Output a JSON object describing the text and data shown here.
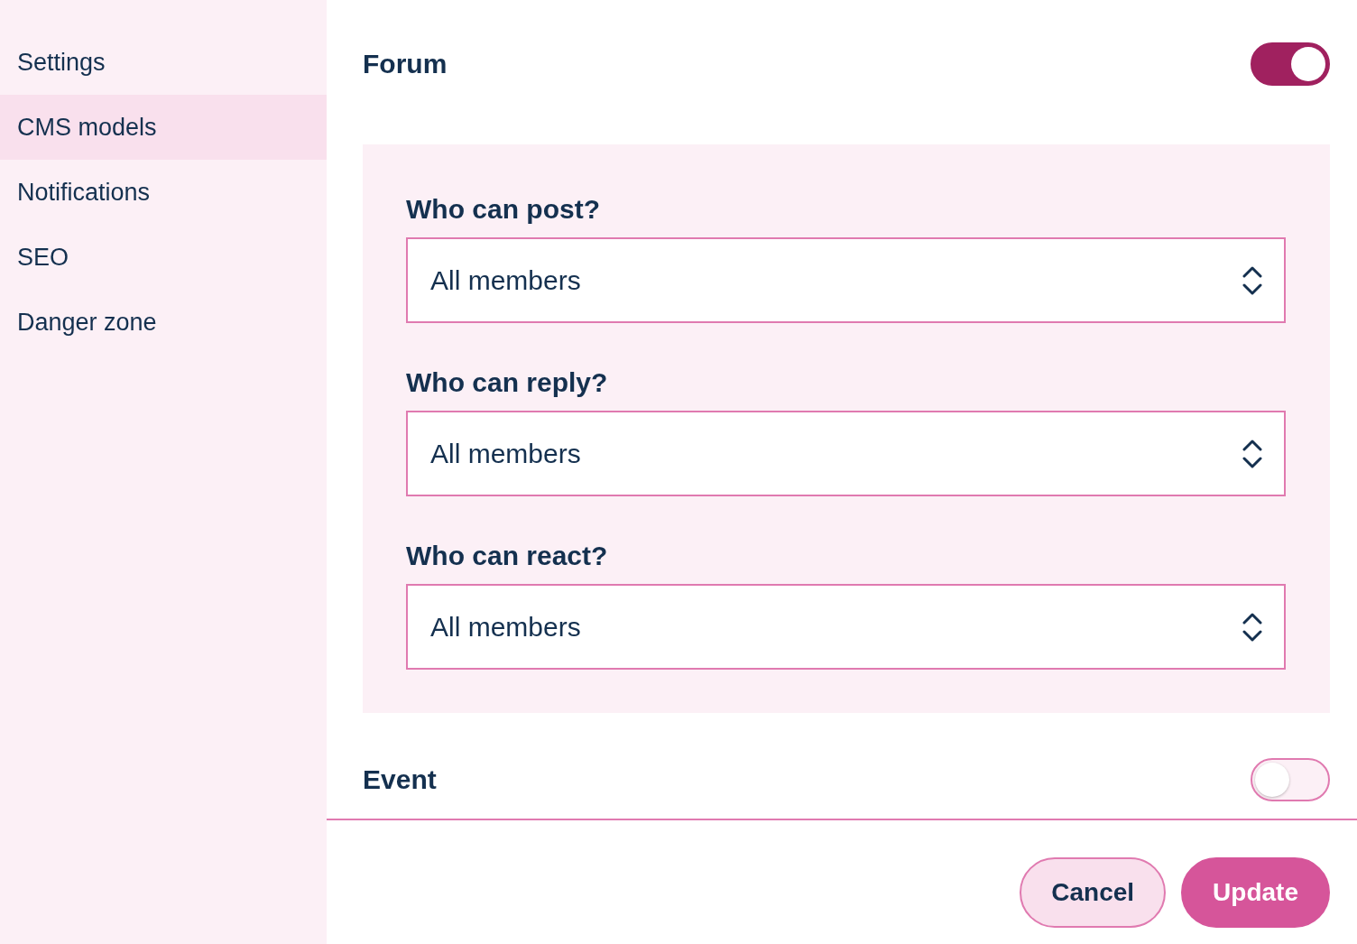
{
  "sidebar": {
    "items": [
      {
        "label": "Settings",
        "selected": false
      },
      {
        "label": "CMS models",
        "selected": true
      },
      {
        "label": "Notifications",
        "selected": false
      },
      {
        "label": "SEO",
        "selected": false
      },
      {
        "label": "Danger zone",
        "selected": false
      }
    ]
  },
  "sections": [
    {
      "title": "Forum",
      "on": true,
      "fields": [
        {
          "label": "Who can post?",
          "value": "All members"
        },
        {
          "label": "Who can reply?",
          "value": "All members"
        },
        {
          "label": "Who can react?",
          "value": "All members"
        }
      ]
    },
    {
      "title": "Event",
      "on": false
    }
  ],
  "buttons": [
    {
      "label": "Cancel",
      "kind": "secondary"
    },
    {
      "label": "Update",
      "kind": "primary"
    }
  ]
}
